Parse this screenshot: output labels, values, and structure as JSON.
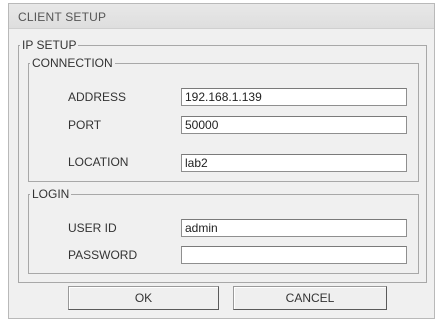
{
  "window": {
    "title": "CLIENT SETUP"
  },
  "ip_setup": {
    "legend": "IP SETUP",
    "connection": {
      "legend": "CONNECTION",
      "address": {
        "label": "ADDRESS",
        "value": "192.168.1.139"
      },
      "port": {
        "label": "PORT",
        "value": "50000"
      },
      "location": {
        "label": "LOCATION",
        "value": "lab2"
      }
    },
    "login": {
      "legend": "LOGIN",
      "user_id": {
        "label": "USER ID",
        "value": "admin"
      },
      "password": {
        "label": "PASSWORD",
        "value": ""
      }
    }
  },
  "buttons": {
    "ok_label": "OK",
    "cancel_label": "CANCEL"
  }
}
